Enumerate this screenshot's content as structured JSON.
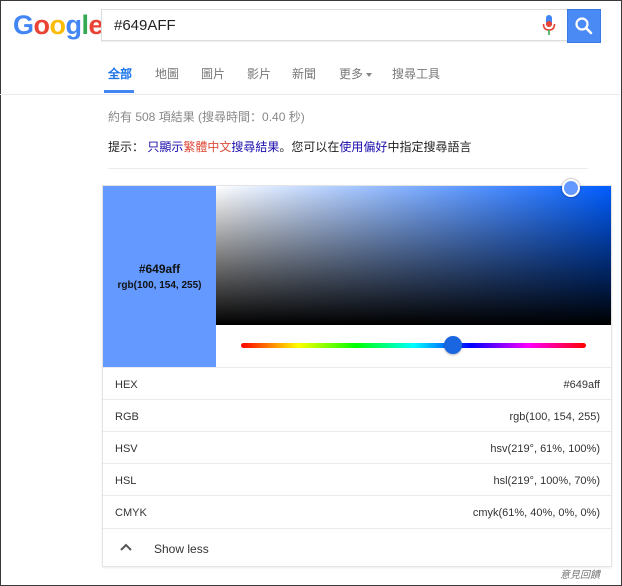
{
  "logo": {
    "letters": [
      "G",
      "o",
      "o",
      "g",
      "l",
      "e"
    ],
    "colors": [
      "#4285f4",
      "#ea4335",
      "#fbbc05",
      "#4285f4",
      "#34a853",
      "#ea4335"
    ]
  },
  "search": {
    "query": "#649AFF"
  },
  "tabs": [
    {
      "label": "全部",
      "active": true
    },
    {
      "label": "地圖"
    },
    {
      "label": "圖片"
    },
    {
      "label": "影片"
    },
    {
      "label": "新聞"
    },
    {
      "label": "更多"
    },
    {
      "label": "搜尋工具"
    }
  ],
  "stats": "約有 508 項結果 (搜尋時間：0.40 秒)",
  "hint": {
    "prefix": "提示：",
    "p1": "只顯示",
    "p2": "繁體中文",
    "p3": "搜尋結果",
    "mid": "。您可以在",
    "link": "使用偏好",
    "suffix": "中指定搜尋語言"
  },
  "color": {
    "hex_display": "#649aff",
    "rgb_display": "rgb(100, 154, 255)",
    "swatch": "#649aff",
    "hue_degrees": 219
  },
  "rows": [
    {
      "label": "HEX",
      "value": "#649aff"
    },
    {
      "label": "RGB",
      "value": "rgb(100, 154, 255)"
    },
    {
      "label": "HSV",
      "value": "hsv(219°, 61%, 100%)"
    },
    {
      "label": "HSL",
      "value": "hsl(219°, 100%, 70%)"
    },
    {
      "label": "CMYK",
      "value": "cmyk(61%, 40%, 0%, 0%)"
    }
  ],
  "show_less": "Show less",
  "feedback": "意見回饋"
}
